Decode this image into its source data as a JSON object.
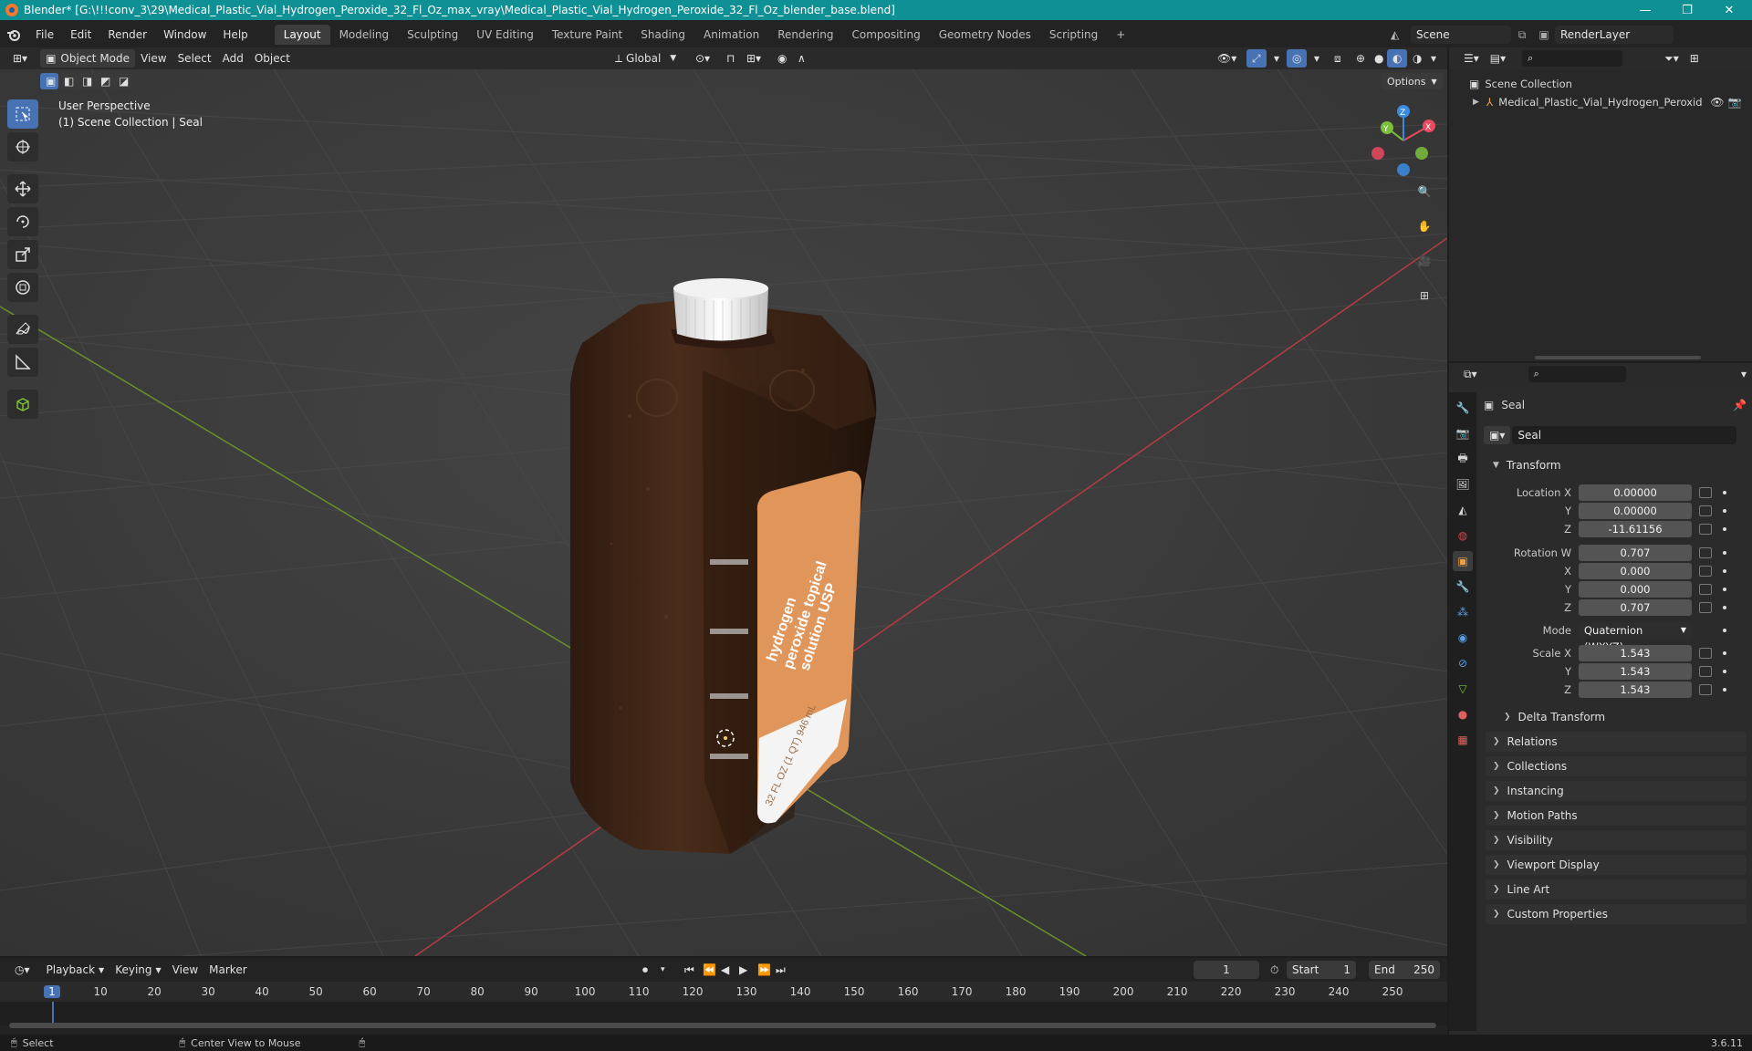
{
  "window": {
    "title": "Blender* [G:\\!!!conv_3\\29\\Medical_Plastic_Vial_Hydrogen_Peroxide_32_Fl_Oz_max_vray\\Medical_Plastic_Vial_Hydrogen_Peroxide_32_Fl_Oz_blender_base.blend]",
    "minimize": "—",
    "maximize": "❐",
    "close": "✕"
  },
  "menus": [
    "File",
    "Edit",
    "Render",
    "Window",
    "Help"
  ],
  "workspaces": [
    "Layout",
    "Modeling",
    "Sculpting",
    "UV Editing",
    "Texture Paint",
    "Shading",
    "Animation",
    "Rendering",
    "Compositing",
    "Geometry Nodes",
    "Scripting"
  ],
  "active_workspace": "Layout",
  "add_workspace": "+",
  "scene": {
    "label": "Scene",
    "render_layer": "RenderLayer"
  },
  "viewport_header": {
    "mode": "Object Mode",
    "menus": [
      "View",
      "Select",
      "Add",
      "Object"
    ],
    "orientation": "Global",
    "options": "Options"
  },
  "viewport": {
    "perspective": "User Perspective",
    "collection_path": "(1) Scene Collection | Seal",
    "gizmo_axes": {
      "x": "X",
      "y": "Y",
      "z": "Z"
    }
  },
  "bottle_label": {
    "line1": "hydrogen",
    "line2": "peroxide topical",
    "line3": "solution USP",
    "volume": "32 FL OZ (1 QT) 946 mL"
  },
  "outliner": {
    "root": "Scene Collection",
    "item": "Medical_Plastic_Vial_Hydrogen_Peroxid"
  },
  "properties": {
    "object_name": "Seal",
    "data_name": "Seal",
    "transform_header": "Transform",
    "location": {
      "label": "Location X",
      "x": "0.00000",
      "y": "0.00000",
      "z": "-11.61156"
    },
    "rotation": {
      "label": "Rotation W",
      "w": "0.707",
      "x": "0.000",
      "y": "0.000",
      "z": "0.707"
    },
    "axis_labels": {
      "x": "X",
      "y": "Y",
      "z": "Z"
    },
    "mode_label": "Mode",
    "mode_value": "Quaternion (WXYZ)",
    "scale": {
      "label": "Scale X",
      "x": "1.543",
      "y": "1.543",
      "z": "1.543"
    },
    "delta_transform": "Delta Transform",
    "panels": [
      "Relations",
      "Collections",
      "Instancing",
      "Motion Paths",
      "Visibility",
      "Viewport Display",
      "Line Art",
      "Custom Properties"
    ]
  },
  "timeline": {
    "menus": [
      "Playback",
      "Keying",
      "View",
      "Marker"
    ],
    "current_frame": "1",
    "start_label": "Start",
    "start": "1",
    "end_label": "End",
    "end": "250",
    "ticks": [
      "1",
      "10",
      "20",
      "30",
      "40",
      "50",
      "60",
      "70",
      "80",
      "90",
      "100",
      "110",
      "120",
      "130",
      "140",
      "150",
      "160",
      "170",
      "180",
      "190",
      "200",
      "210",
      "220",
      "230",
      "240",
      "250"
    ]
  },
  "statusbar": {
    "select": "Select",
    "center_view": "Center View to Mouse",
    "version": "3.6.11"
  },
  "colors": {
    "titlebar": "#0f9094",
    "accent": "#4772b3",
    "label_orange": "#e0955a",
    "axis_x": "#e84a5f",
    "axis_y": "#7bbf3a",
    "axis_z": "#3b8ce0"
  }
}
